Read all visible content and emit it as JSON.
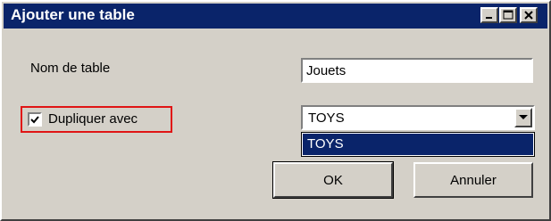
{
  "window": {
    "title": "Ajouter une table"
  },
  "form": {
    "table_name_label": "Nom de table",
    "table_name_value": "Jouets",
    "duplicate_label": "Dupliquer avec",
    "duplicate_checked": true,
    "duplicate_source_value": "TOYS",
    "duplicate_source_options": [
      "TOYS"
    ]
  },
  "buttons": {
    "ok_label": "OK",
    "cancel_label": "Annuler"
  },
  "colors": {
    "titlebar": "#0a246a",
    "highlight": "#e01515",
    "dialog_bg": "#d4d0c8"
  }
}
